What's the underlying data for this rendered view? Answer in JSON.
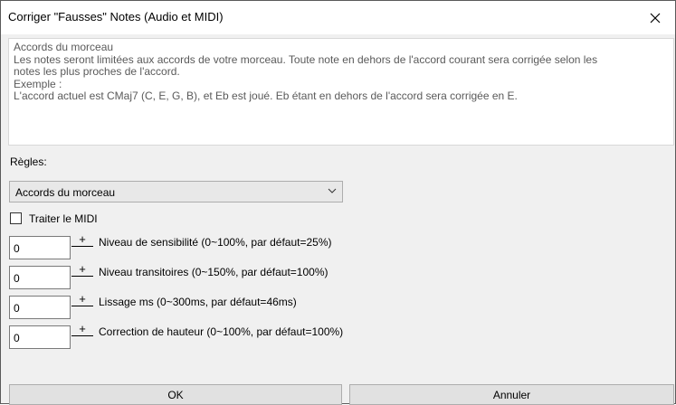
{
  "window": {
    "title": "Corriger \"Fausses\" Notes (Audio et MIDI)",
    "close_glyph": "✕"
  },
  "description": {
    "lines": [
      "Accords du morceau",
      "Les notes seront limitées aux accords de votre morceau. Toute note en dehors de l'accord courant sera corrigée selon les",
      "notes les plus proches de l'accord.",
      "Exemple :",
      "L'accord actuel est CMaj7 (C, E, G, B), et Eb est joué. Eb étant en dehors de l'accord sera corrigée en E."
    ]
  },
  "rules": {
    "label": "Règles:",
    "selected": "Accords du morceau"
  },
  "midi": {
    "label": "Traiter le MIDI",
    "checked": false
  },
  "spinners": [
    {
      "value": "0",
      "plus": "+",
      "minus": "—",
      "label": "Niveau de sensibilité (0~100%, par défaut=25%)"
    },
    {
      "value": "0",
      "plus": "+",
      "minus": "—",
      "label": "Niveau transitoires (0~150%, par défaut=100%)"
    },
    {
      "value": "0",
      "plus": "+",
      "minus": "—",
      "label": "Lissage ms (0~300ms, par défaut=46ms)"
    },
    {
      "value": "0",
      "plus": "+",
      "minus": "—",
      "label": "Correction de hauteur (0~100%, par défaut=100%)"
    }
  ],
  "buttons": {
    "ok": "OK",
    "cancel": "Annuler"
  }
}
